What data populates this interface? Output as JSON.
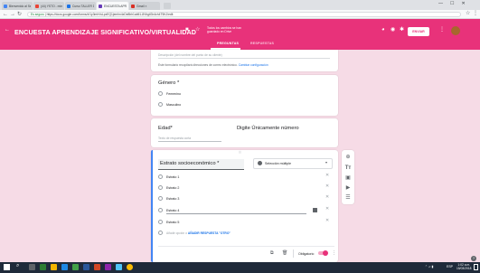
{
  "browser": {
    "tabs": [
      {
        "title": "Bienvenido al Seminario ×",
        "color": "#4285f4"
      },
      {
        "title": "(44) YSTO - mimas@elgmm ×",
        "color": "#ea4335"
      },
      {
        "title": "Curso TALLER DE TÍTULO ×",
        "color": "#1a73e8"
      },
      {
        "title": "ENCUESTA APRENDIZAJE S ×",
        "color": "#673ab7"
      },
      {
        "title": "Gmail ×",
        "color": "#d93025"
      }
    ],
    "address_prefix": "Es seguro",
    "address": "https://docs.google.com/forms/d/1y3mhVsLpxEQ1jemhn4xDe8bh1ab51-8VbgtGb4ch4T5KJ/edit"
  },
  "form_header": {
    "title": "ENCUESTA APRENDIZAJE SIGNIFICATIVO/VIRTUALIDAD",
    "saved_text": "Todos los cambios se han guardado en Drive",
    "send_label": "ENVIAR",
    "tabs": [
      "PREGUNTAS",
      "RESPUESTAS"
    ],
    "accent_color": "#e8327a"
  },
  "top_card": {
    "desc_placeholder": "Descripción (del nombre del punto de su cliente)",
    "email_note": "Este formulario recopilará direcciones de correo electrónico.",
    "email_link": "Cambiar configuración"
  },
  "genero": {
    "title": "Género *",
    "options": [
      "Femenino",
      "Masculino"
    ]
  },
  "edad": {
    "title": "Edad*",
    "hint": "Digite Únicamente número",
    "answer_placeholder": "Texto de respuesta corta"
  },
  "estrato": {
    "title": "Estrato socioeconómico *",
    "type_label": "Selección múltiple",
    "options": [
      "Estrato 1",
      "Estrato 2",
      "Estrato 3",
      "Estrato 4",
      "Estrato 5"
    ],
    "add_option": "Añadir opción",
    "add_other_prefix": "o",
    "add_other": "AÑADIR RESPUESTA \"OTRO\"",
    "required_label": "Obligatorio",
    "required_on": true
  },
  "sidebar_tools": [
    "add-circle-icon",
    "title-icon",
    "image-icon",
    "video-icon",
    "section-icon"
  ],
  "taskbar": {
    "time": "1:02 a.m.",
    "date": "15/03/2018",
    "lang": "ESP"
  }
}
